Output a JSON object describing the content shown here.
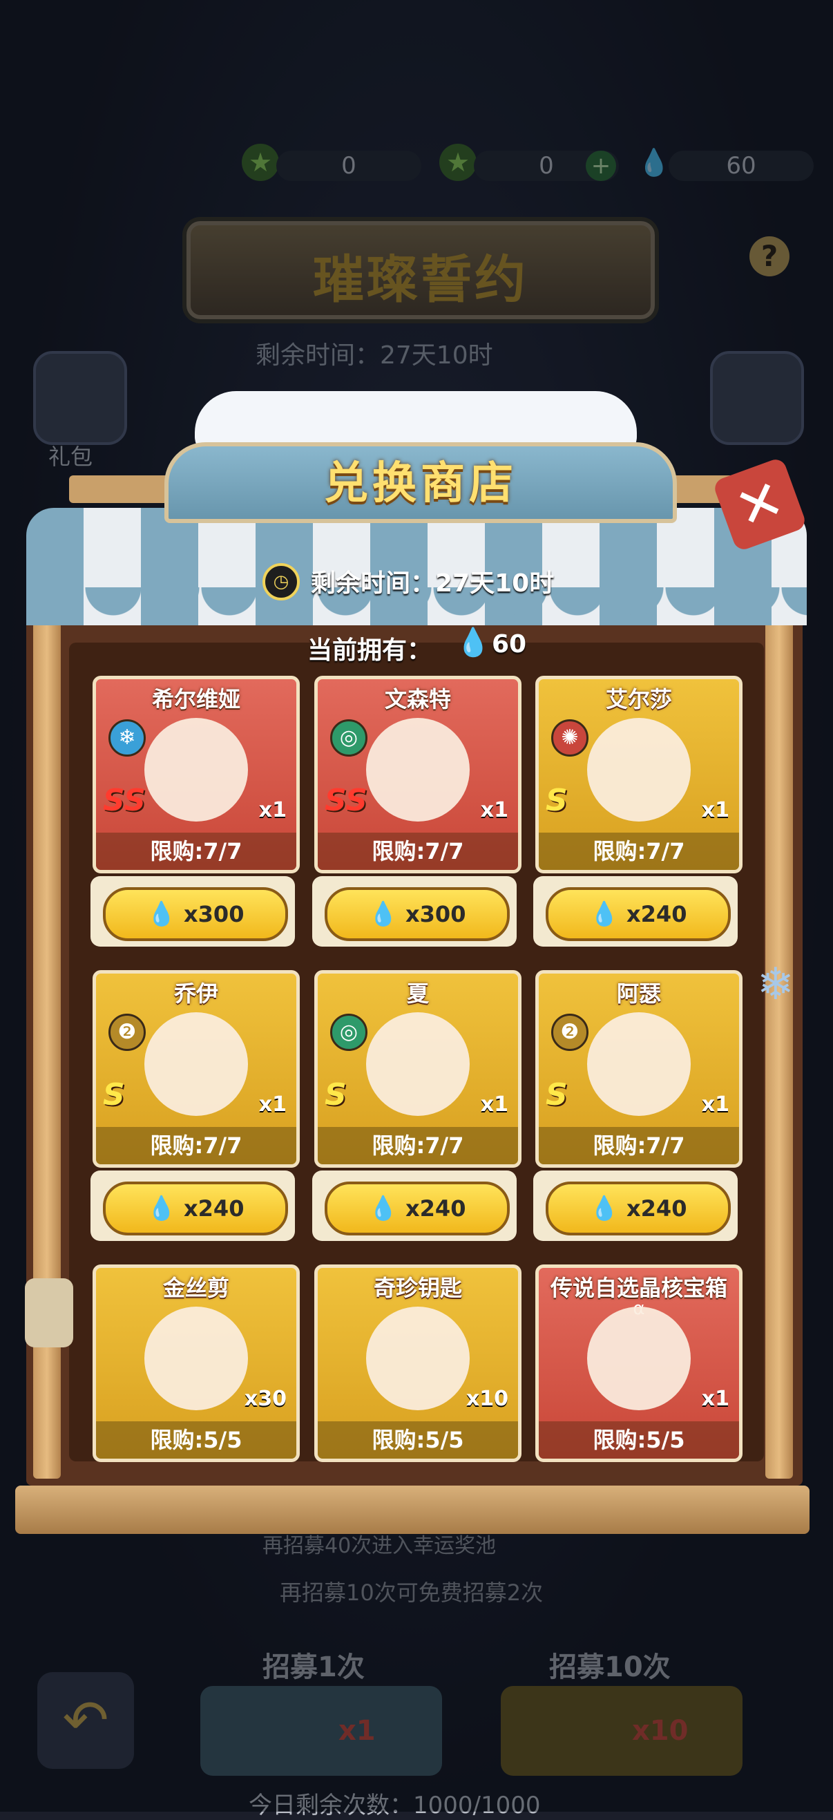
{
  "currency": {
    "star_a": "0",
    "star_b": "0",
    "gems": "60"
  },
  "background": {
    "event_title": "璀璨誓约",
    "remaining": "剩余时间：27天10时",
    "gift_label": "礼包",
    "recruit_lucky_hint": "再招募40次进入幸运奖池",
    "recruit_free_hint": "再招募10次可免费招募2次",
    "recruit_1_label": "招募1次",
    "recruit_1_cost": "x1",
    "recruit_10_label": "招募10次",
    "recruit_10_cost": "x10",
    "daily_remaining": "今日剩余次数：1000/1000"
  },
  "shop": {
    "title": "兑换商店",
    "remaining_time": "剩余时间：27天10时",
    "owned_label": "当前拥有：",
    "owned_value": "60",
    "items": [
      {
        "name": "希尔维娅",
        "rank": "SS",
        "qty": "x1",
        "limit": "限购:7/7",
        "price": "x300",
        "color": "red",
        "element": "wind"
      },
      {
        "name": "文森特",
        "rank": "SS",
        "qty": "x1",
        "limit": "限购:7/7",
        "price": "x300",
        "color": "red",
        "element": "vortex"
      },
      {
        "name": "艾尔莎",
        "rank": "S",
        "qty": "x1",
        "limit": "限购:7/7",
        "price": "x240",
        "color": "gold",
        "element": "fire"
      },
      {
        "name": "乔伊",
        "rank": "S",
        "qty": "x1",
        "limit": "限购:7/7",
        "price": "x240",
        "color": "gold",
        "element": "earth"
      },
      {
        "name": "夏",
        "rank": "S",
        "qty": "x1",
        "limit": "限购:7/7",
        "price": "x240",
        "color": "gold",
        "element": "vortex"
      },
      {
        "name": "阿瑟",
        "rank": "S",
        "qty": "x1",
        "limit": "限购:7/7",
        "price": "x240",
        "color": "gold",
        "element": "earth"
      },
      {
        "name": "金丝剪",
        "qty": "x30",
        "limit": "限购:5/5",
        "color": "gold"
      },
      {
        "name": "奇珍钥匙",
        "qty": "x10",
        "limit": "限购:5/5",
        "color": "gold"
      },
      {
        "name": "传说自选晶核宝箱",
        "sub": "α",
        "qty": "x1",
        "limit": "限购:5/5",
        "color": "red"
      }
    ]
  },
  "colors": {
    "accent_gold": "#ffe070",
    "card_red": "#e26a5c",
    "card_gold": "#f0c23c",
    "gem_blue": "#4aa6e6"
  }
}
